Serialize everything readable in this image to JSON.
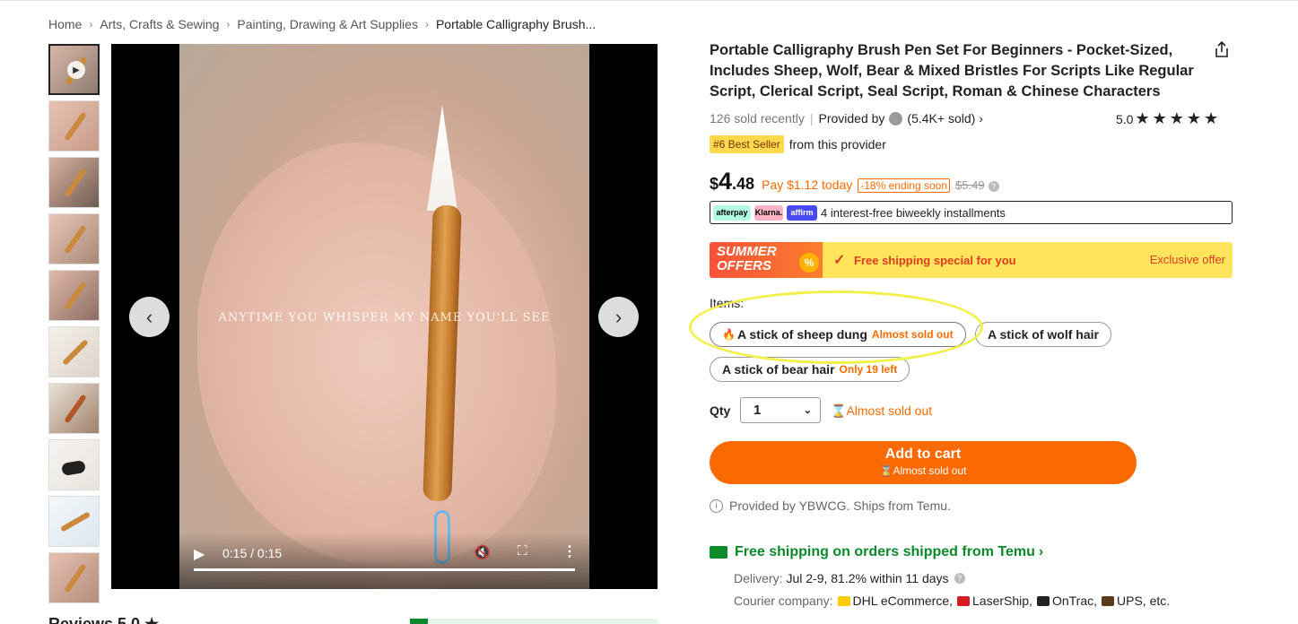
{
  "breadcrumb": [
    "Home",
    "Arts, Crafts & Sewing",
    "Painting, Drawing & Art Supplies",
    "Portable Calligraphy Brush..."
  ],
  "gallery": {
    "thumbnail_count": 10,
    "video": {
      "overlay_text": "ANYTIME YOU WHISPER MY NAME YOU'LL SEE",
      "time": "0:15 / 0:15"
    }
  },
  "product": {
    "title": "Portable Calligraphy Brush Pen Set For Beginners - Pocket-Sized, Includes Sheep, Wolf, Bear & Mixed Bristles For Scripts Like Regular Script, Clerical Script, Seal Script, Roman & Chinese Characters",
    "sold_recently": "126 sold recently",
    "provided_by": "Provided by",
    "seller_sold": "(5.4K+ sold)",
    "rating": "5.0",
    "stars": "★★★★★",
    "best_seller_badge": "#6 Best Seller",
    "best_seller_suffix": "from this provider"
  },
  "price": {
    "currency": "$",
    "integer": "4",
    "decimal": ".48",
    "pay_today": "Pay $1.12 today",
    "discount": "-18% ending soon",
    "original": "$5.49"
  },
  "installments": {
    "logos": [
      "afterpay",
      "Klarna.",
      "affirm"
    ],
    "text": "4 interest-free biweekly installments"
  },
  "promo": {
    "summer_line1": "SUMMER",
    "summer_line2": "OFFERS",
    "percent": "%",
    "free_shipping": "Free shipping special for you",
    "exclusive": "Exclusive offer"
  },
  "items": {
    "label": "Items:",
    "options": [
      {
        "label": "A stick of sheep dung",
        "stock": "Almost sold out"
      },
      {
        "label": "A stick of wolf hair",
        "stock": ""
      },
      {
        "label": "A stick of bear hair",
        "stock": "Only 19 left"
      }
    ]
  },
  "qty": {
    "label": "Qty",
    "value": "1",
    "warning": "Almost sold out"
  },
  "cart": {
    "label": "Add to cart",
    "sub": "Almost sold out"
  },
  "shipping": {
    "provided": "Provided by YBWCG. Ships from Temu.",
    "free_line": "Free shipping on orders shipped from Temu",
    "delivery_label": "Delivery:",
    "delivery_value": "Jul 2-9, 81.2% within 11 days",
    "courier_label": "Courier company:",
    "carriers": [
      "DHL eCommerce,",
      "LaserShip,",
      "OnTrac,",
      "UPS, etc."
    ],
    "carrier_colors": [
      "#ffcc00",
      "#d71920",
      "#222222",
      "#5a3a1a"
    ]
  },
  "reviews_peek": "Reviews 5.0 ★"
}
